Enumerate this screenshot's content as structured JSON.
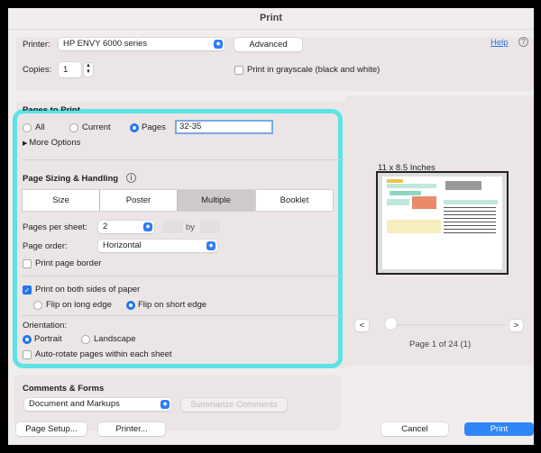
{
  "title": "Print",
  "printer": {
    "label": "Printer:",
    "value": "HP ENVY 6000 series",
    "advanced": "Advanced",
    "help": "Help",
    "help_icon": "?"
  },
  "copies": {
    "label": "Copies:",
    "value": "1",
    "grayscale": "Print in grayscale (black and white)",
    "grayscale_checked": false
  },
  "pages": {
    "heading": "Pages to Print",
    "all": "All",
    "current": "Current",
    "pages": "Pages",
    "range": "32-35",
    "selected": "Pages",
    "more": "More Options"
  },
  "sizing": {
    "heading": "Page Sizing & Handling",
    "info_icon": "i",
    "tabs": [
      "Size",
      "Poster",
      "Multiple",
      "Booklet"
    ],
    "active_tab": "Multiple",
    "pps_label": "Pages per sheet:",
    "pps_value": "2",
    "by": "by",
    "order_label": "Page order:",
    "order_value": "Horizontal",
    "border": "Print page border",
    "border_checked": false
  },
  "duplex": {
    "both_sides": "Print on both sides of paper",
    "both_checked": true,
    "long": "Flip on long edge",
    "short": "Flip on short edge",
    "selected": "short"
  },
  "orientation": {
    "label": "Orientation:",
    "portrait": "Portrait",
    "landscape": "Landscape",
    "selected": "Portrait",
    "autorotate": "Auto-rotate pages within each sheet",
    "autorotate_checked": false
  },
  "comments": {
    "heading": "Comments & Forms",
    "value": "Document and Markups",
    "summarize": "Summarize Comments"
  },
  "preview": {
    "size": "11 x 8.5 Inches",
    "prev": "<",
    "next": ">",
    "page_info": "Page 1 of 24 (1)",
    "slider_position": 1,
    "page_count": 24
  },
  "footer": {
    "page_setup": "Page Setup...",
    "printer": "Printer...",
    "cancel": "Cancel",
    "print": "Print"
  },
  "colors": {
    "accent": "#1f77f0",
    "highlight": "#5de3e6"
  }
}
